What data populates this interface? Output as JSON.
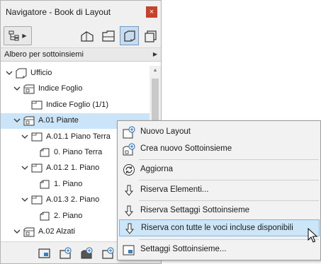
{
  "window": {
    "title": "Navigatore - Book di Layout",
    "close_glyph": "×"
  },
  "toolbar": {
    "left_button_icon": "tree-structure-icon",
    "view_buttons": [
      {
        "name": "project-map-icon",
        "active": false
      },
      {
        "name": "view-map-icon",
        "active": false
      },
      {
        "name": "layout-book-icon",
        "active": true
      },
      {
        "name": "publisher-sets-icon",
        "active": false
      }
    ]
  },
  "dropdown": {
    "selected": "Albero per sottoinsiemi"
  },
  "tree": {
    "items": [
      {
        "label": "Ufficio",
        "type": "book",
        "expanded": true,
        "selected": false
      },
      {
        "label": "Indice Foglio",
        "type": "subset",
        "expanded": true,
        "selected": false
      },
      {
        "label": "Indice Foglio (1/1)",
        "type": "layout",
        "expanded": false,
        "selected": false
      },
      {
        "label": "A.01 Piante",
        "type": "subset",
        "expanded": true,
        "selected": true
      },
      {
        "label": "A.01.1 Piano Terra",
        "type": "layout",
        "expanded": true,
        "selected": false
      },
      {
        "label": "0. Piano Terra",
        "type": "drawing",
        "expanded": false,
        "selected": false
      },
      {
        "label": "A.01.2 1. Piano",
        "type": "layout",
        "expanded": true,
        "selected": false
      },
      {
        "label": "1. Piano",
        "type": "drawing",
        "expanded": false,
        "selected": false
      },
      {
        "label": "A.01.3 2. Piano",
        "type": "layout",
        "expanded": true,
        "selected": false
      },
      {
        "label": "2. Piano",
        "type": "drawing",
        "expanded": false,
        "selected": false
      },
      {
        "label": "A.02 Alzati",
        "type": "subset",
        "expanded": true,
        "selected": false
      }
    ]
  },
  "bottombar": {
    "buttons": [
      "layout-settings-icon",
      "new-layout-icon",
      "new-subset-icon",
      "new-master-icon"
    ]
  },
  "context_menu": {
    "items": [
      {
        "label": "Nuovo Layout",
        "icon": "new-layout-icon",
        "highlight": false
      },
      {
        "label": "Crea nuovo Sottoinsieme",
        "icon": "new-subset-icon",
        "highlight": false
      },
      {
        "label": "Aggiorna",
        "icon": "refresh-icon",
        "highlight": false
      },
      {
        "label": "Riserva Elementi...",
        "icon": "reserve-arrow-icon",
        "highlight": false
      },
      {
        "label": "Riserva Settaggi Sottoinsieme",
        "icon": "reserve-arrow-icon",
        "highlight": false
      },
      {
        "label": "Riserva con tutte le voci incluse disponibili",
        "icon": "reserve-arrow-icon",
        "highlight": true
      },
      {
        "label": "Settaggi Sottoinsieme...",
        "icon": "subset-settings-icon",
        "highlight": false
      }
    ]
  },
  "colors": {
    "selection": "#cce4f7",
    "menu_highlight": "#cde6f7",
    "close_button": "#c8412a",
    "active_toolbar_button": "#c7dcef"
  }
}
